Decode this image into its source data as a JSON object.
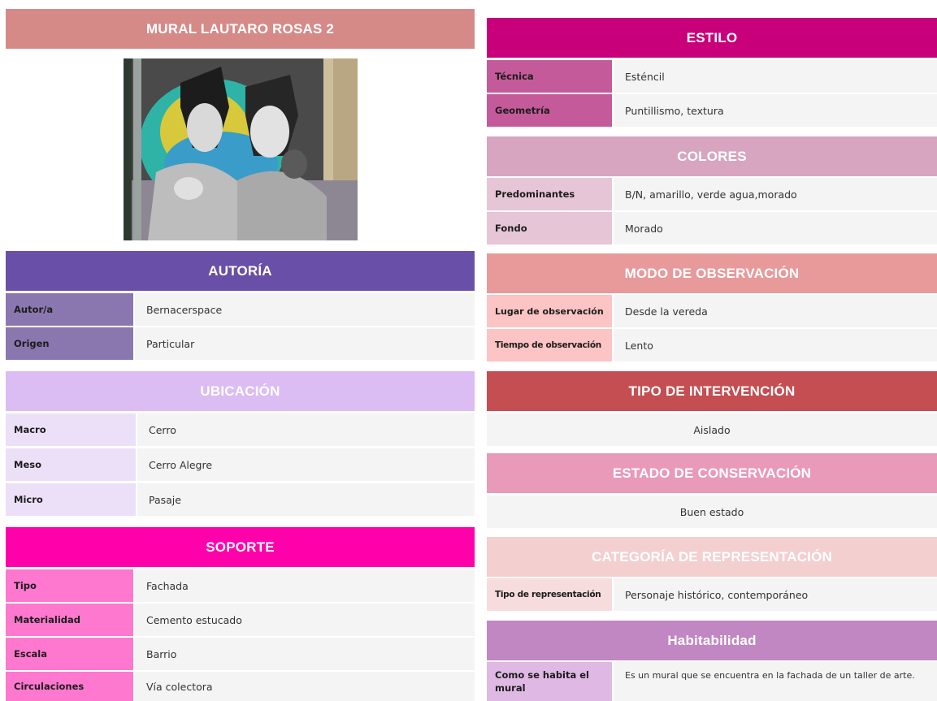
{
  "title": "MURAL LAUTARO ROSAS 2",
  "autoria": {
    "header": "AUTORÍA",
    "rows": [
      {
        "label": "Autor/a",
        "value": "Bernacerspace"
      },
      {
        "label": "Origen",
        "value": "Particular"
      }
    ]
  },
  "ubicacion": {
    "header": "UBICACIÓN",
    "rows": [
      {
        "label": "Macro",
        "value": "Cerro"
      },
      {
        "label": "Meso",
        "value": "Cerro Alegre"
      },
      {
        "label": "Micro",
        "value": "Pasaje"
      }
    ]
  },
  "soporte": {
    "header": "SOPORTE",
    "rows": [
      {
        "label": "Tipo",
        "value": "Fachada"
      },
      {
        "label": "Materialidad",
        "value": "Cemento estucado"
      },
      {
        "label": "Escala",
        "value": "Barrio"
      },
      {
        "label": "Circulaciones",
        "value": "Vía colectora"
      }
    ]
  },
  "estilo": {
    "header": "ESTILO",
    "rows": [
      {
        "label": "Técnica",
        "value": "Esténcil"
      },
      {
        "label": "Geometría",
        "value": "Puntillismo, textura"
      }
    ]
  },
  "colores": {
    "header": "COLORES",
    "rows": [
      {
        "label": "Predominantes",
        "value": "B/N, amarillo, verde agua,morado"
      },
      {
        "label": "Fondo",
        "value": "Morado"
      }
    ]
  },
  "observacion": {
    "header": "MODO DE OBSERVACIÓN",
    "rows": [
      {
        "label": "Lugar de observación",
        "value": "Desde la vereda"
      },
      {
        "label": "Tiempo de observación",
        "value": "Lento"
      }
    ]
  },
  "intervencion": {
    "header": "TIPO DE INTERVENCIÓN",
    "value": "Aislado"
  },
  "conservacion": {
    "header": "ESTADO DE CONSERVACIÓN",
    "value": "Buen estado"
  },
  "representacion": {
    "header": "CATEGORÍA DE REPRESENTACIÓN",
    "rows": [
      {
        "label": "Tipo de representación",
        "value": "Personaje histórico, contemporáneo"
      }
    ]
  },
  "habitabilidad": {
    "header": "Habitabilidad",
    "rows": [
      {
        "label": "Como se habita el mural",
        "value": "Es un mural que se encuentra en la fachada de un taller de arte."
      }
    ]
  },
  "colors": {
    "title": "#d68a87",
    "autoria": "#6a4fa8",
    "autoria_label": "#8b77b0",
    "ubicacion": "#dbbcf3",
    "ubicacion_label": "#ece0f8",
    "soporte": "#ff00aa",
    "soporte_label": "#ff78cf",
    "estilo": "#c8007a",
    "estilo_label": "#c45a9a",
    "colores": "#d7a5bf",
    "colores_label": "#e6c5d6",
    "observacion": "#e89a9b",
    "observacion_label": "#fcc4c4",
    "intervencion": "#c44e52",
    "conservacion": "#e89ab8",
    "representacion": "#f4cfd0",
    "representacion_label": "#f6dcdd",
    "habitabilidad": "#c187c2",
    "habitabilidad_label": "#e0b8e4",
    "value_bg": "#f4f4f5"
  },
  "icons": {
    "photo": "mural-photo"
  }
}
